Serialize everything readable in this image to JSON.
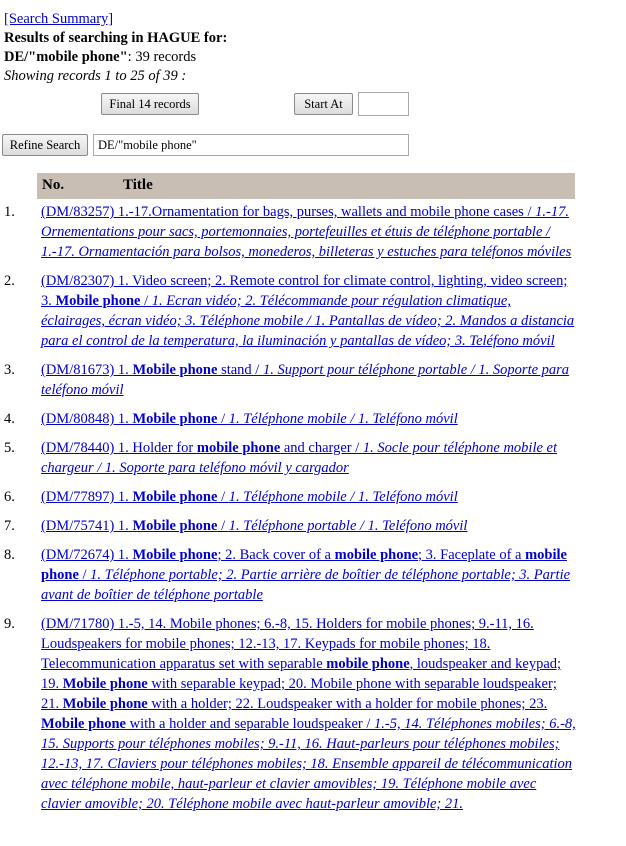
{
  "header": {
    "summary_link": "[Search Summary]",
    "results_line": "Results of searching in HAGUE for:",
    "query_bold": "DE/\"mobile phone\"",
    "query_count": ": 39 records",
    "showing": "Showing records 1 to 25 of 39 :"
  },
  "controls": {
    "final_button": "Final 14 records",
    "start_button": "Start At",
    "start_value": "",
    "refine_button": "Refine Search",
    "refine_value": "DE/\"mobile phone\""
  },
  "table": {
    "col_no": "No.",
    "col_title": "Title"
  },
  "rows": [
    {
      "num": "1.",
      "parts": [
        {
          "t": "(DM/83257) 1.-17.Ornamentation for bags, purses, wallets and mobile phone cases / "
        },
        {
          "t": "1.-17. Ornementations pour sacs, portemonnaies, portefeuilles et étuis de téléphone portable / 1.-17. Ornamentación para bolsos, monederos, billeteras y estuches para teléfonos móviles",
          "i": true
        }
      ]
    },
    {
      "num": "2.",
      "parts": [
        {
          "t": "(DM/82307) 1. Video screen; 2. Remote control for climate control, lighting, video screen; 3. "
        },
        {
          "t": "Mobile phone",
          "b": true
        },
        {
          "t": " / "
        },
        {
          "t": "1. Ecran vidéo; 2. Télécommande pour régulation climatique, éclairages, écran vidéo; 3. Téléphone mobile / 1. Pantallas de vídeo; 2. Mandos a distancia para el control de la temperatura, la iluminación y pantallas de vídeo; 3. Teléfono móvil",
          "i": true
        }
      ]
    },
    {
      "num": "3.",
      "parts": [
        {
          "t": "(DM/81673) 1. "
        },
        {
          "t": "Mobile phone",
          "b": true
        },
        {
          "t": " stand / "
        },
        {
          "t": "1. Support pour téléphone portable / 1. Soporte para teléfono móvil",
          "i": true
        }
      ]
    },
    {
      "num": "4.",
      "parts": [
        {
          "t": "(DM/80848) 1. "
        },
        {
          "t": "Mobile phone",
          "b": true
        },
        {
          "t": " / "
        },
        {
          "t": "1. Téléphone mobile / 1. Teléfono móvil",
          "i": true
        }
      ]
    },
    {
      "num": "5.",
      "parts": [
        {
          "t": "(DM/78440) 1. Holder for "
        },
        {
          "t": "mobile phone",
          "b": true
        },
        {
          "t": " and charger / "
        },
        {
          "t": "1. Socle pour téléphone mobile et chargeur / 1. Soporte para teléfono móvil y cargador",
          "i": true
        }
      ]
    },
    {
      "num": "6.",
      "parts": [
        {
          "t": "(DM/77897) 1. "
        },
        {
          "t": "Mobile phone",
          "b": true
        },
        {
          "t": " / "
        },
        {
          "t": "1. Téléphone mobile / 1. Teléfono móvil",
          "i": true
        }
      ]
    },
    {
      "num": "7.",
      "parts": [
        {
          "t": "(DM/75741) 1. "
        },
        {
          "t": "Mobile phone",
          "b": true
        },
        {
          "t": " / "
        },
        {
          "t": "1. Téléphone portable / 1. Teléfono móvil",
          "i": true
        }
      ]
    },
    {
      "num": "8.",
      "parts": [
        {
          "t": "(DM/72674) 1. "
        },
        {
          "t": "Mobile phone",
          "b": true
        },
        {
          "t": "; 2. Back cover of a "
        },
        {
          "t": "mobile phone",
          "b": true
        },
        {
          "t": "; 3. Faceplate of a "
        },
        {
          "t": "mobile phone",
          "b": true
        },
        {
          "t": " / "
        },
        {
          "t": "1. Téléphone portable; 2. Partie arrière de boîtier de téléphone portable; 3. Partie avant de boîtier de téléphone portable",
          "i": true
        }
      ]
    },
    {
      "num": "9.",
      "parts": [
        {
          "t": "(DM/71780) 1.-5, 14. Mobile phones; 6.-8, 15. Holders for mobile phones; 9.-11, 16. Loudspeakers for mobile phones; 12.-13, 17. Keypads for mobile phones; 18. Telecommunication apparatus set with separable "
        },
        {
          "t": "mobile phone",
          "b": true
        },
        {
          "t": ", loudspeaker and keypad; 19. "
        },
        {
          "t": "Mobile phone",
          "b": true
        },
        {
          "t": " with separable keypad; 20. Mobile phone with separable loudspeaker; 21. "
        },
        {
          "t": "Mobile phone",
          "b": true
        },
        {
          "t": " with a holder; 22. Loudspeaker with a holder for mobile phones; 23. "
        },
        {
          "t": "Mobile phone",
          "b": true
        },
        {
          "t": " with a holder and separable loudspeaker / "
        },
        {
          "t": "1.-5, 14. Téléphones mobiles; 6.-8, 15. Supports pour téléphones mobiles; 9.-11, 16. Haut-parleurs pour téléphones mobiles; 12.-13, 17. Claviers pour téléphones mobiles; 18. Ensemble appareil de télécommunication avec téléphone mobile, haut-parleur et clavier amovibles; 19. Téléphone mobile avec clavier amovible; 20. Téléphone mobile avec haut-parleur amovible; 21.",
          "i": true
        }
      ]
    }
  ]
}
